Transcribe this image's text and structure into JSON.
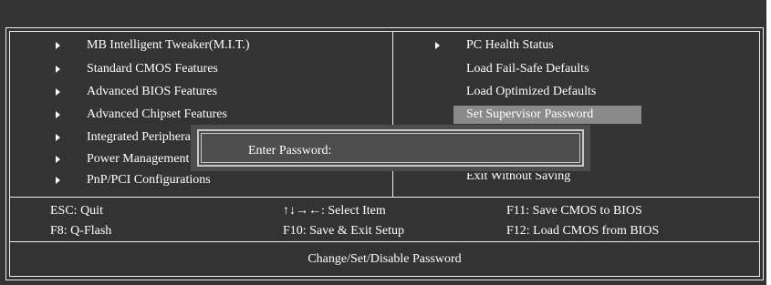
{
  "left_menu": [
    {
      "label": "MB Intelligent Tweaker(M.I.T.)"
    },
    {
      "label": "Standard CMOS Features"
    },
    {
      "label": "Advanced BIOS Features"
    },
    {
      "label": "Advanced Chipset Features"
    },
    {
      "label": "Integrated Peripherals"
    },
    {
      "label": "Power Management Setup"
    },
    {
      "label": "PnP/PCI Configurations"
    }
  ],
  "right_menu": [
    {
      "label": "PC Health Status"
    },
    {
      "label": "Load Fail-Safe Defaults"
    },
    {
      "label": "Load Optimized Defaults"
    },
    {
      "label": "Set Supervisor Password"
    },
    {
      "label": "Exit Without Saving"
    }
  ],
  "keys": {
    "esc": "ESC: Quit",
    "select": "↑↓→←: Select Item",
    "f11": "F11: Save CMOS to BIOS",
    "f8": "F8: Q-Flash",
    "f10": "F10: Save & Exit Setup",
    "f12": "F12: Load CMOS from BIOS"
  },
  "status_text": "Change/Set/Disable Password",
  "dialog": {
    "prompt": "Enter Password:"
  },
  "colors": {
    "background": "#333333",
    "selected": "#8a8a8a",
    "border": "#ececec"
  }
}
